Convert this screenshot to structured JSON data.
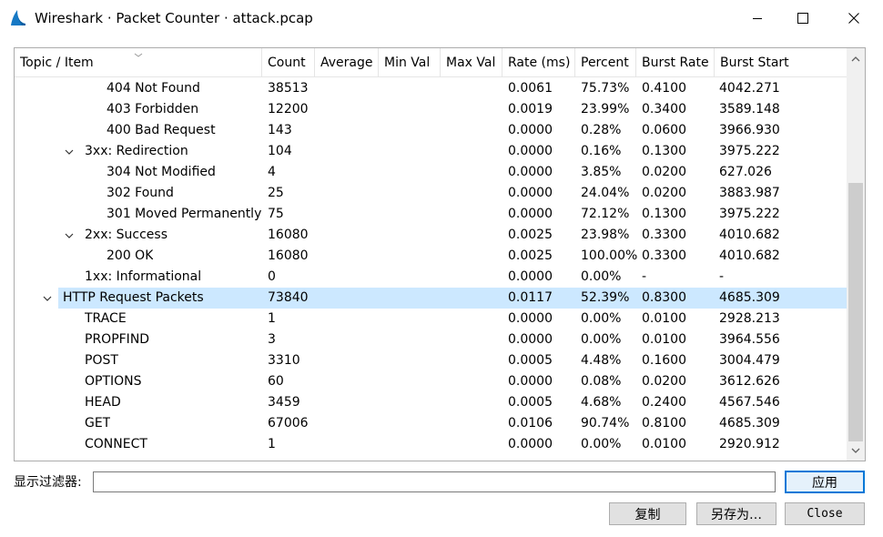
{
  "window": {
    "title": "Wireshark · Packet Counter · attack.pcap"
  },
  "table": {
    "columns": [
      "Topic / Item",
      "Count",
      "Average",
      "Min Val",
      "Max Val",
      "Rate (ms)",
      "Percent",
      "Burst Rate",
      "Burst Start"
    ],
    "rows": [
      {
        "item": "404 Not Found",
        "count": "38513",
        "average": "",
        "min": "",
        "max": "",
        "rate": "0.0061",
        "percent": "75.73%",
        "burst_rate": "0.4100",
        "burst_start": "4042.271"
      },
      {
        "item": "403 Forbidden",
        "count": "12200",
        "average": "",
        "min": "",
        "max": "",
        "rate": "0.0019",
        "percent": "23.99%",
        "burst_rate": "0.3400",
        "burst_start": "3589.148"
      },
      {
        "item": "400 Bad Request",
        "count": "143",
        "average": "",
        "min": "",
        "max": "",
        "rate": "0.0000",
        "percent": "0.28%",
        "burst_rate": "0.0600",
        "burst_start": "3966.930"
      },
      {
        "item": "3xx: Redirection",
        "count": "104",
        "average": "",
        "min": "",
        "max": "",
        "rate": "0.0000",
        "percent": "0.16%",
        "burst_rate": "0.1300",
        "burst_start": "3975.222"
      },
      {
        "item": "304 Not Modified",
        "count": "4",
        "average": "",
        "min": "",
        "max": "",
        "rate": "0.0000",
        "percent": "3.85%",
        "burst_rate": "0.0200",
        "burst_start": "627.026"
      },
      {
        "item": "302 Found",
        "count": "25",
        "average": "",
        "min": "",
        "max": "",
        "rate": "0.0000",
        "percent": "24.04%",
        "burst_rate": "0.0200",
        "burst_start": "3883.987"
      },
      {
        "item": "301 Moved Permanently",
        "count": "75",
        "average": "",
        "min": "",
        "max": "",
        "rate": "0.0000",
        "percent": "72.12%",
        "burst_rate": "0.1300",
        "burst_start": "3975.222"
      },
      {
        "item": "2xx: Success",
        "count": "16080",
        "average": "",
        "min": "",
        "max": "",
        "rate": "0.0025",
        "percent": "23.98%",
        "burst_rate": "0.3300",
        "burst_start": "4010.682"
      },
      {
        "item": "200 OK",
        "count": "16080",
        "average": "",
        "min": "",
        "max": "",
        "rate": "0.0025",
        "percent": "100.00%",
        "burst_rate": "0.3300",
        "burst_start": "4010.682"
      },
      {
        "item": "1xx: Informational",
        "count": "0",
        "average": "",
        "min": "",
        "max": "",
        "rate": "0.0000",
        "percent": "0.00%",
        "burst_rate": "-",
        "burst_start": "-"
      },
      {
        "item": "HTTP Request Packets",
        "count": "73840",
        "average": "",
        "min": "",
        "max": "",
        "rate": "0.0117",
        "percent": "52.39%",
        "burst_rate": "0.8300",
        "burst_start": "4685.309"
      },
      {
        "item": "TRACE",
        "count": "1",
        "average": "",
        "min": "",
        "max": "",
        "rate": "0.0000",
        "percent": "0.00%",
        "burst_rate": "0.0100",
        "burst_start": "2928.213"
      },
      {
        "item": "PROPFIND",
        "count": "3",
        "average": "",
        "min": "",
        "max": "",
        "rate": "0.0000",
        "percent": "0.00%",
        "burst_rate": "0.0100",
        "burst_start": "3964.556"
      },
      {
        "item": "POST",
        "count": "3310",
        "average": "",
        "min": "",
        "max": "",
        "rate": "0.0005",
        "percent": "4.48%",
        "burst_rate": "0.1600",
        "burst_start": "3004.479"
      },
      {
        "item": "OPTIONS",
        "count": "60",
        "average": "",
        "min": "",
        "max": "",
        "rate": "0.0000",
        "percent": "0.08%",
        "burst_rate": "0.0200",
        "burst_start": "3612.626"
      },
      {
        "item": "HEAD",
        "count": "3459",
        "average": "",
        "min": "",
        "max": "",
        "rate": "0.0005",
        "percent": "4.68%",
        "burst_rate": "0.2400",
        "burst_start": "4567.546"
      },
      {
        "item": "GET",
        "count": "67006",
        "average": "",
        "min": "",
        "max": "",
        "rate": "0.0106",
        "percent": "90.74%",
        "burst_rate": "0.8100",
        "burst_start": "4685.309"
      },
      {
        "item": "CONNECT",
        "count": "1",
        "average": "",
        "min": "",
        "max": "",
        "rate": "0.0000",
        "percent": "0.00%",
        "burst_rate": "0.0100",
        "burst_start": "2920.912"
      }
    ]
  },
  "filter": {
    "label": "显示过滤器:",
    "value": "",
    "apply_label": "应用"
  },
  "buttons": {
    "copy_label": "复制",
    "save_as_label": "另存为…",
    "close_label": "Close"
  },
  "colors": {
    "selection": "#cce8ff",
    "accent": "#0078d7"
  }
}
